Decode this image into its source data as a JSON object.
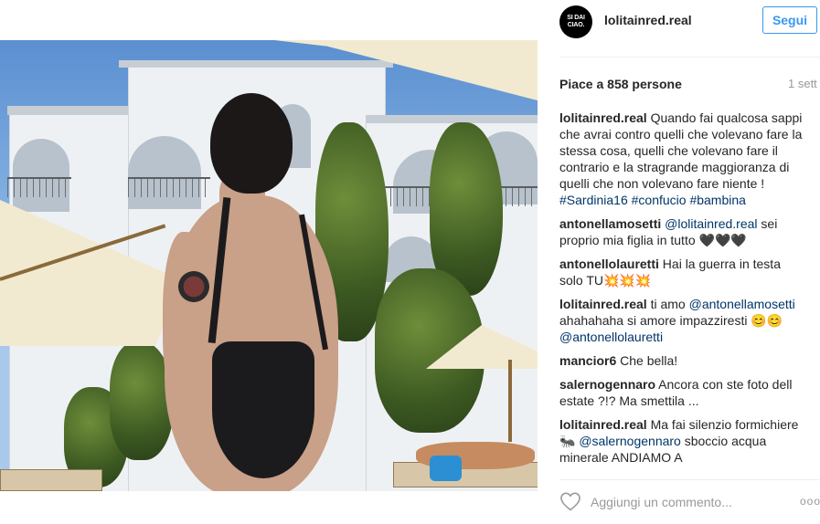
{
  "header": {
    "avatar_text": "SI DAI CIAO.",
    "username": "lolitainred.real",
    "follow_label": "Segui"
  },
  "post": {
    "likes_text": "Piace a 858 persone",
    "time_text": "1 sett"
  },
  "comments": [
    {
      "author": "lolitainred.real",
      "text": " Quando fai qualcosa sappi che avrai contro quelli che volevano fare la stessa cosa, quelli che volevano fare il contrario e la stragrande maggioranza di quelli che non volevano fare niente ! ",
      "links": [
        "#Sardinia16",
        "#confucio",
        "#bambina"
      ]
    },
    {
      "author": "antonellamosetti",
      "mention": "@lolitainred.real",
      "text": " sei proprio mia figlia in tutto 🖤🖤🖤"
    },
    {
      "author": "antonellolauretti",
      "text": " Hai la guerra in testa solo TU💥💥💥"
    },
    {
      "author": "lolitainred.real",
      "text_before": " ti amo ",
      "mention": "@antonellamosetti",
      "text_after": " ahahahaha si amore impazziresti 😊😊 ",
      "mention2": "@antonellolauretti"
    },
    {
      "author": "mancior6",
      "text": " Che bella!"
    },
    {
      "author": "salernogennaro",
      "text": " Ancora con ste foto dell estate ?!? Ma smettila ..."
    },
    {
      "author": "lolitainred.real",
      "text_before": " Ma fai silenzio formichiere 🐜 ",
      "mention": "@salernogennaro",
      "text_after": " sboccio acqua minerale ANDIAMO A"
    }
  ],
  "add_comment": {
    "placeholder": "Aggiungi un commento...",
    "more_label": "ooo"
  },
  "colors": {
    "follow_blue": "#3897f0",
    "link_blue": "#003569",
    "muted": "#999999"
  },
  "icons": {
    "like": "heart-outline-icon",
    "more": "more-options-icon"
  }
}
